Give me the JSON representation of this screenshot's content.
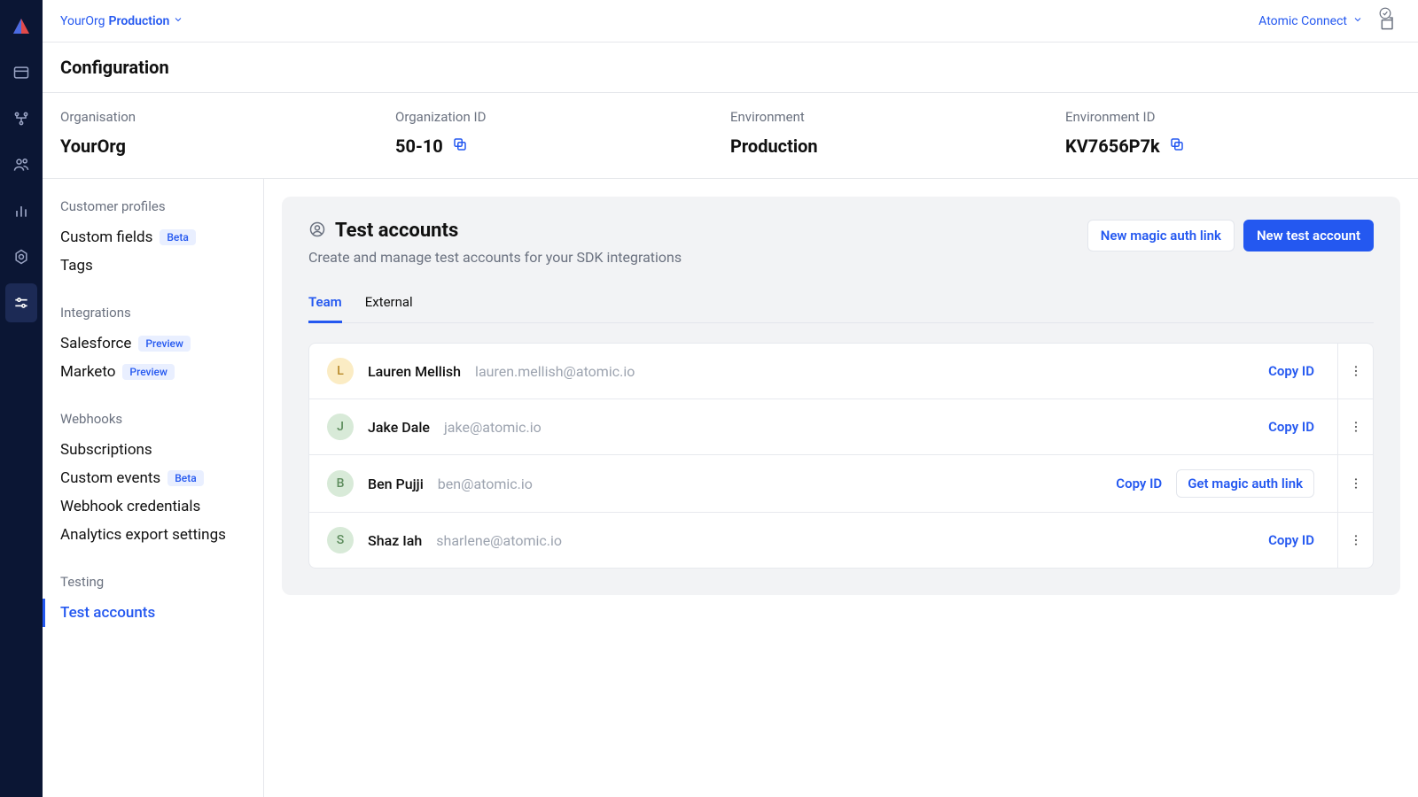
{
  "topbar": {
    "org": "YourOrg",
    "env": "Production",
    "connect": "Atomic Connect"
  },
  "page_title": "Configuration",
  "info": {
    "org_label": "Organisation",
    "org_value": "YourOrg",
    "orgid_label": "Organization ID",
    "orgid_value": "50-10",
    "env_label": "Environment",
    "env_value": "Production",
    "envid_label": "Environment ID",
    "envid_value": "KV7656P7k"
  },
  "sidenav": {
    "groups": [
      {
        "heading": "Customer profiles",
        "items": [
          {
            "label": "Custom fields",
            "badge": "Beta"
          },
          {
            "label": "Tags"
          }
        ]
      },
      {
        "heading": "Integrations",
        "items": [
          {
            "label": "Salesforce",
            "badge": "Preview"
          },
          {
            "label": "Marketo",
            "badge": "Preview"
          }
        ]
      },
      {
        "heading": "Webhooks",
        "items": [
          {
            "label": "Subscriptions"
          },
          {
            "label": "Custom events",
            "badge": "Beta"
          },
          {
            "label": "Webhook credentials"
          },
          {
            "label": "Analytics export settings"
          }
        ]
      },
      {
        "heading": "Testing",
        "items": [
          {
            "label": "Test accounts",
            "active": true
          }
        ]
      }
    ]
  },
  "panel": {
    "title": "Test accounts",
    "subtitle": "Create and manage test accounts for your SDK integrations",
    "btn_outline": "New magic auth link",
    "btn_primary": "New test account",
    "tabs": [
      {
        "label": "Team",
        "active": true
      },
      {
        "label": "External"
      }
    ],
    "copy_label": "Copy ID",
    "magic_label": "Get magic auth link",
    "rows": [
      {
        "initial": "L",
        "bg": "#fbecc4",
        "fg": "#b88a2a",
        "name": "Lauren Mellish",
        "email": "lauren.mellish@atomic.io",
        "magic": false
      },
      {
        "initial": "J",
        "bg": "#d8ead8",
        "fg": "#5d8c5d",
        "name": "Jake Dale",
        "email": "jake@atomic.io",
        "magic": false
      },
      {
        "initial": "B",
        "bg": "#d8ead8",
        "fg": "#5d8c5d",
        "name": "Ben Pujji",
        "email": "ben@atomic.io",
        "magic": true
      },
      {
        "initial": "S",
        "bg": "#d8ead8",
        "fg": "#5d8c5d",
        "name": "Shaz Iah",
        "email": "sharlene@atomic.io",
        "magic": false
      }
    ]
  }
}
